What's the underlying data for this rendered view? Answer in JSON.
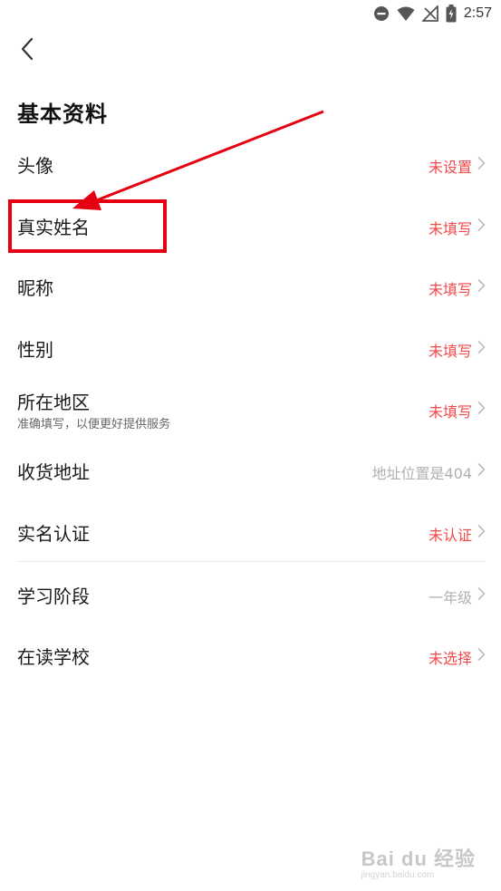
{
  "status_bar": {
    "time": "2:57",
    "icons": [
      "dnd-icon",
      "wifi-icon",
      "no-signal-icon",
      "battery-icon"
    ]
  },
  "header": {
    "back_icon": "chevron-left-icon",
    "title": "基本资料"
  },
  "items": [
    {
      "label": "头像",
      "value": "未设置",
      "value_style": "red"
    },
    {
      "label": "真实姓名",
      "value": "未填写",
      "value_style": "red"
    },
    {
      "label": "昵称",
      "value": "未填写",
      "value_style": "red"
    },
    {
      "label": "性别",
      "value": "未填写",
      "value_style": "red"
    },
    {
      "label": "所在地区",
      "sublabel": "准确填写，以便更好提供服务",
      "value": "未填写",
      "value_style": "red"
    },
    {
      "label": "收货地址",
      "value": "地址位置是404",
      "value_style": "gray"
    },
    {
      "label": "实名认证",
      "value": "未认证",
      "value_style": "red"
    },
    {
      "label": "学习阶段",
      "value": "一年级",
      "value_style": "gray"
    },
    {
      "label": "在读学校",
      "value": "未选择",
      "value_style": "red"
    }
  ],
  "colors": {
    "accent_red": "#f04a4a",
    "muted_gray": "#b0b0b0",
    "annotation_red": "#e60012"
  },
  "watermark": {
    "main": "Bai du 经验",
    "sub": "jingyan.baidu.com"
  }
}
